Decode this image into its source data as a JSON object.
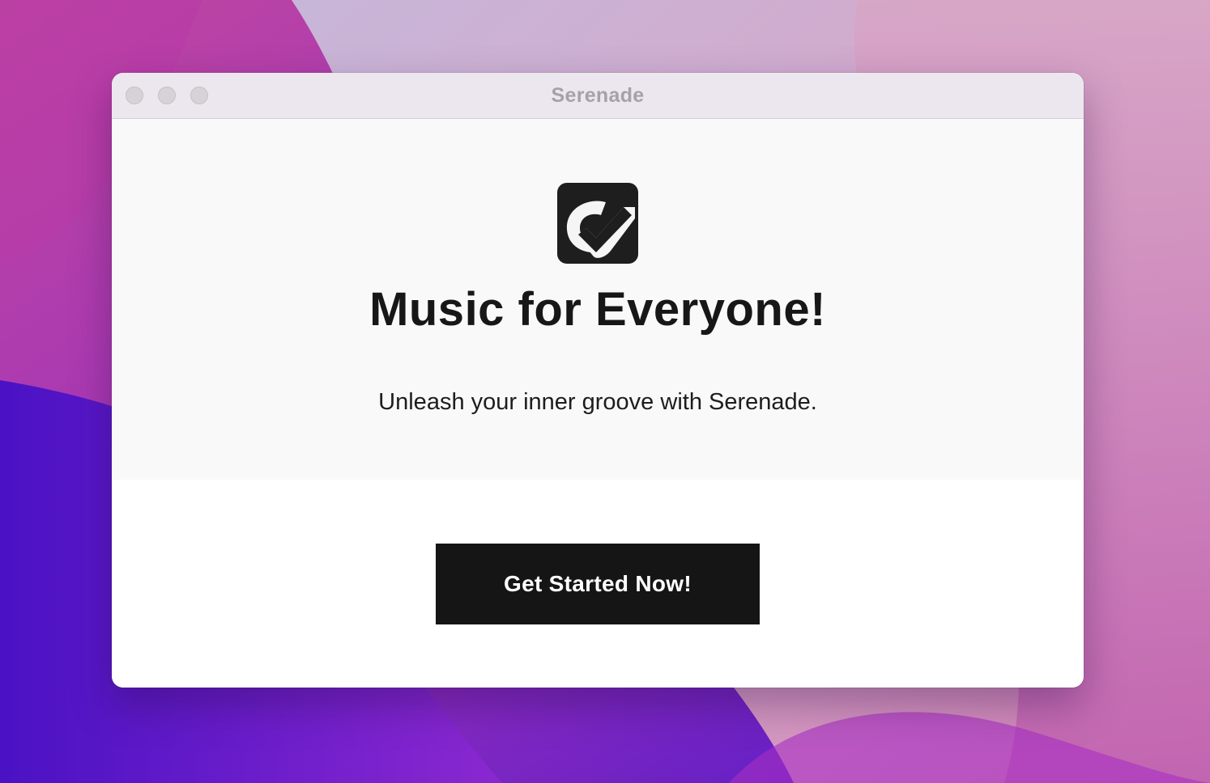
{
  "window": {
    "title": "Serenade"
  },
  "onboarding": {
    "logo_icon": "serenade-logo-icon",
    "headline": "Music for Everyone!",
    "tagline": "Unleash your inner groove with Serenade.",
    "cta_label": "Get Started Now!"
  },
  "colors": {
    "cta_background": "#151515",
    "cta_text": "#ffffff",
    "hero_background": "#f9f9f9",
    "titlebar_background": "#ece7ee"
  }
}
